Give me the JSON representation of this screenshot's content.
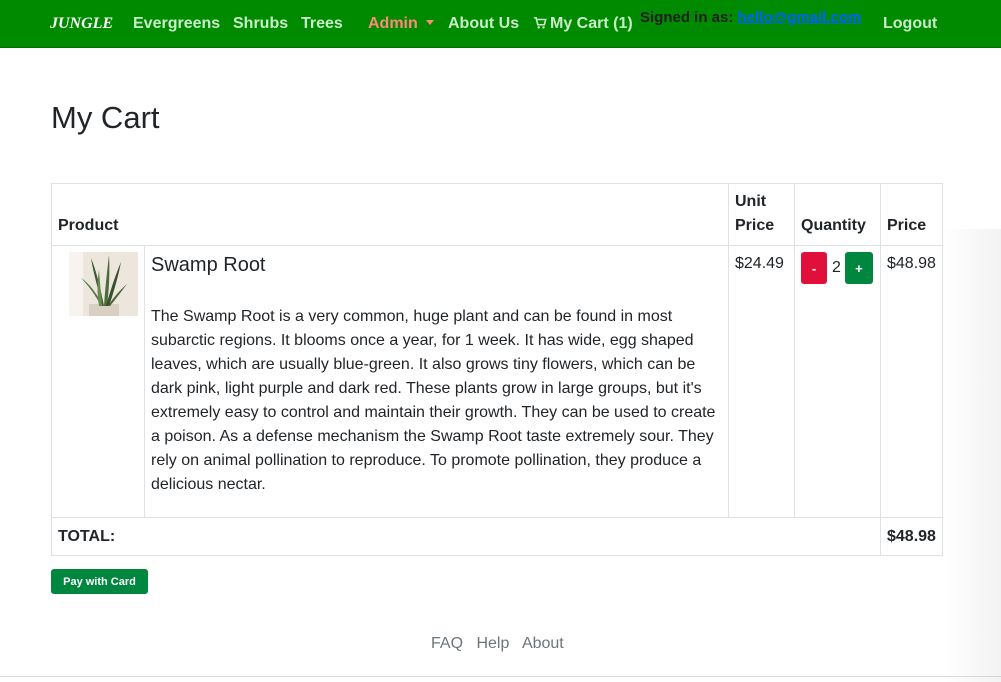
{
  "navbar": {
    "brand": "JUNGLE",
    "links": [
      "Evergreens",
      "Shrubs",
      "Trees"
    ],
    "admin_label": "Admin",
    "about_label": "About Us",
    "cart_label": "My Cart (1)",
    "signed_in_label": "Signed in as:",
    "email": "hello@gmail.com",
    "logout_label": "Logout"
  },
  "page": {
    "title": "My Cart"
  },
  "table": {
    "headers": {
      "product": "Product",
      "unit_price": "Unit Price",
      "quantity": "Quantity",
      "price": "Price"
    },
    "items": [
      {
        "name": "Swamp Root",
        "description": "The Swamp Root is a very common, huge plant and can be found in most subarctic regions. It blooms once a year, for 1 week. It has wide, egg shaped leaves, which are usually blue-green. It also grows tiny flowers, which can be dark pink, light purple and dark red. These plants grow in large groups, but it's extremely easy to control and maintain their growth. They can be used to create a poison. As a defense mechanism the Swamp Root taste extremely sour. They rely on animal pollination to reproduce. To promote pollination, they produce a delicious nectar.",
        "unit_price": "$24.49",
        "quantity": "2",
        "minus_label": "-",
        "plus_label": "+",
        "price": "$48.98"
      }
    ],
    "total_label": "TOTAL:",
    "total_value": "$48.98"
  },
  "pay_button": "Pay with Card",
  "footer": {
    "links": [
      "FAQ",
      "Help",
      "About"
    ]
  },
  "colors": {
    "navbar": "#008a00",
    "nav_link": "#c8ebc8",
    "admin": "#ff8a7a",
    "minus": "#e0103a",
    "plus": "#00873f",
    "pay": "#00873f",
    "email": "#0062ff"
  }
}
